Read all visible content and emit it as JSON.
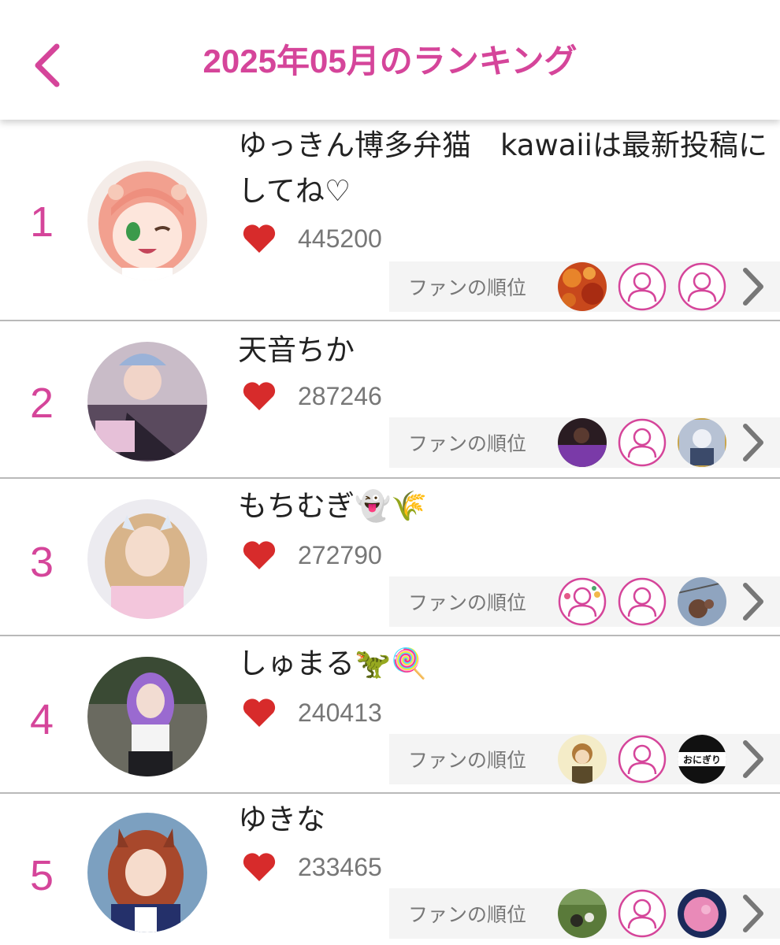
{
  "header": {
    "title": "2025年05月のランキング",
    "back_icon": "chevron-left-icon"
  },
  "colors": {
    "accent": "#d5459a",
    "heart": "#d72b2b",
    "fan_bar_bg": "#f4f4f4",
    "divider": "#b9b9b9",
    "count_text": "#777777"
  },
  "fan_label": "ファンの順位",
  "entries": [
    {
      "rank": "1",
      "name": "ゆっきん博多弁猫　kawaiiは最新投稿にしてね♡",
      "likes": "445200",
      "avatar": "anime-girl-avatar",
      "fans": [
        "autumn-leaves-avatar",
        "default-user-icon",
        "default-user-icon"
      ]
    },
    {
      "rank": "2",
      "name": "天音ちか",
      "likes": "287246",
      "avatar": "cosplayer-photo-avatar",
      "fans": [
        "dark-photo-avatar",
        "default-user-icon",
        "anime-art-avatar"
      ]
    },
    {
      "rank": "3",
      "name": "もちむぎ👻🌾",
      "likes": "272790",
      "avatar": "cosplayer-photo-avatar",
      "fans": [
        "doodle-user-avatar",
        "default-user-icon",
        "outdoor-photo-avatar"
      ]
    },
    {
      "rank": "4",
      "name": "しゅまる🦖🍭",
      "likes": "240413",
      "avatar": "cosplayer-photo-avatar",
      "fans": [
        "illustration-avatar",
        "default-user-icon",
        "onigiri-logo-avatar"
      ]
    },
    {
      "rank": "5",
      "name": "ゆきな",
      "likes": "233465",
      "avatar": "cosplayer-photo-avatar",
      "fans": [
        "grass-photo-avatar",
        "default-user-icon",
        "pink-moon-avatar"
      ]
    }
  ],
  "onigiri_text": "おにぎり"
}
